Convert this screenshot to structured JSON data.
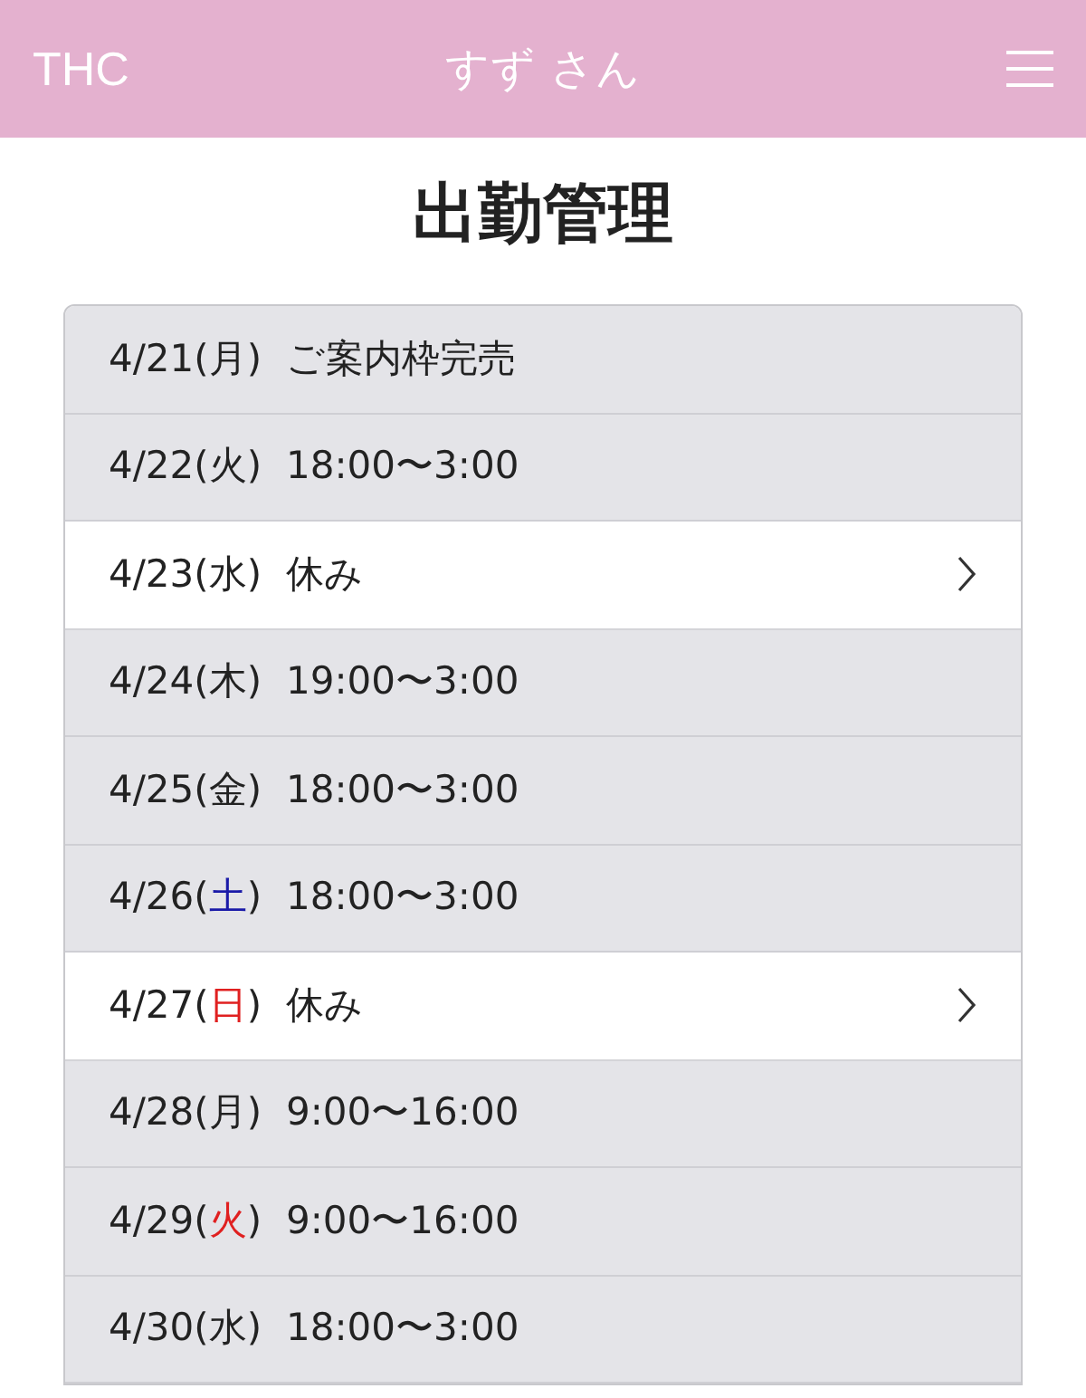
{
  "header": {
    "brand": "THC",
    "user": "すず さん"
  },
  "title": "出勤管理",
  "days": [
    {
      "date": "4/21(",
      "weekday": "月",
      "date_end": ")",
      "color": "#222222",
      "schedule": "ご案内枠完売",
      "editable": false
    },
    {
      "date": "4/22(",
      "weekday": "火",
      "date_end": ")",
      "color": "#222222",
      "schedule": "18:00〜3:00",
      "editable": false
    },
    {
      "date": "4/23(",
      "weekday": "水",
      "date_end": ")",
      "color": "#222222",
      "schedule": "休み",
      "editable": true
    },
    {
      "date": "4/24(",
      "weekday": "木",
      "date_end": ")",
      "color": "#222222",
      "schedule": "19:00〜3:00",
      "editable": false
    },
    {
      "date": "4/25(",
      "weekday": "金",
      "date_end": ")",
      "color": "#222222",
      "schedule": "18:00〜3:00",
      "editable": false
    },
    {
      "date": "4/26(",
      "weekday": "土",
      "date_end": ")",
      "color": "#1a1aa8",
      "schedule": "18:00〜3:00",
      "editable": false
    },
    {
      "date": "4/27(",
      "weekday": "日",
      "date_end": ")",
      "color": "#e02020",
      "schedule": "休み",
      "editable": true
    },
    {
      "date": "4/28(",
      "weekday": "月",
      "date_end": ")",
      "color": "#222222",
      "schedule": "9:00〜16:00",
      "editable": false
    },
    {
      "date": "4/29(",
      "weekday": "火",
      "date_end": ")",
      "color": "#e02020",
      "schedule": "9:00〜16:00",
      "editable": false
    },
    {
      "date": "4/30(",
      "weekday": "水",
      "date_end": ")",
      "color": "#222222",
      "schedule": "18:00〜3:00",
      "editable": false
    }
  ]
}
